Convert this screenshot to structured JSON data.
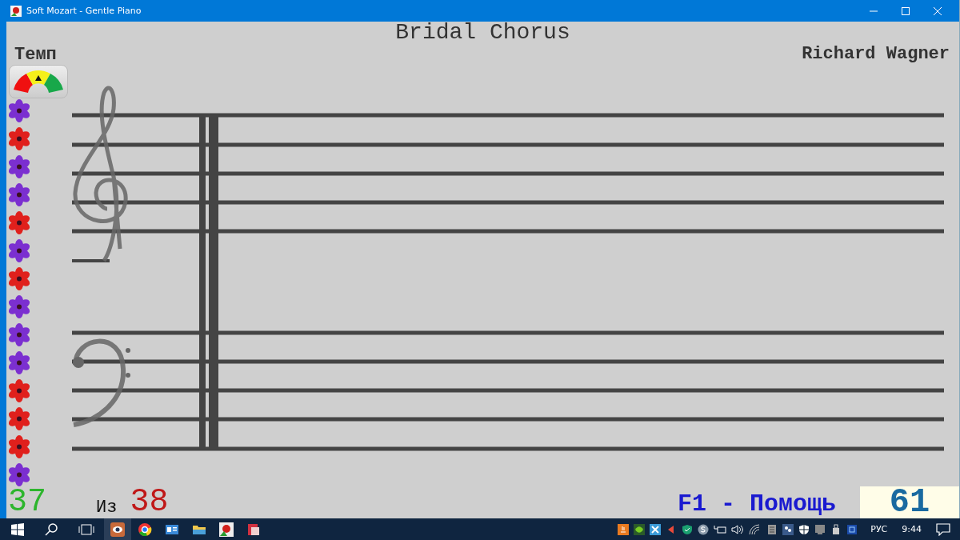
{
  "window": {
    "title": "Soft Mozart - Gentle Piano"
  },
  "score": {
    "title": "Bridal Chorus",
    "composer": "Richard Wagner"
  },
  "tempo": {
    "label": "Темп"
  },
  "flowers": [
    {
      "color": "#7b2fd0"
    },
    {
      "color": "#e0201c"
    },
    {
      "color": "#7b2fd0"
    },
    {
      "color": "#7b2fd0"
    },
    {
      "color": "#e0201c"
    },
    {
      "color": "#7b2fd0"
    },
    {
      "color": "#e0201c"
    },
    {
      "color": "#7b2fd0"
    },
    {
      "color": "#7b2fd0"
    },
    {
      "color": "#7b2fd0"
    },
    {
      "color": "#e0201c"
    },
    {
      "color": "#e0201c"
    },
    {
      "color": "#e0201c"
    },
    {
      "color": "#7b2fd0"
    }
  ],
  "footer": {
    "current": "37",
    "of_label": "Из",
    "total": "38",
    "help": "F1 - Помощь",
    "score_value": "61"
  },
  "taskbar": {
    "language": "РУС",
    "time": "9:44"
  }
}
